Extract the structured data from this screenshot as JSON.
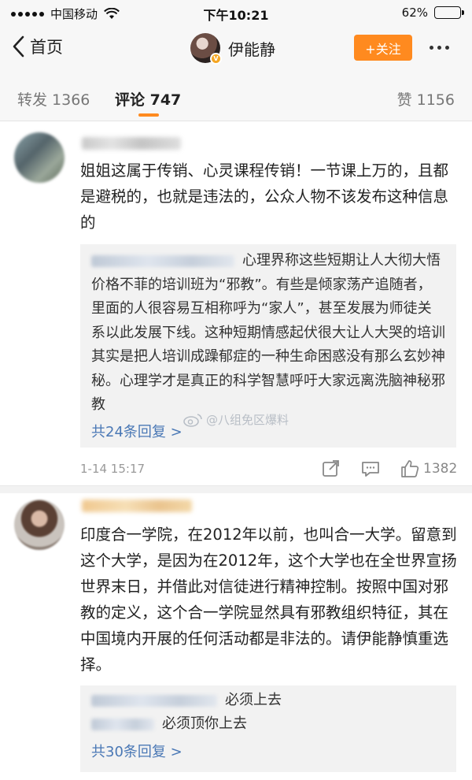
{
  "status_bar": {
    "carrier": "中国移动",
    "time": "下午10:21",
    "battery_percent": "62%",
    "battery_level": 0.62
  },
  "nav": {
    "back_label": "首页",
    "title": "伊能静",
    "follow_label": "+关注"
  },
  "tabs": {
    "repost": "转发 1366",
    "comment": "评论 747",
    "like": "赞 1156"
  },
  "comments": [
    {
      "text": "姐姐这属于传销、心灵课程传销！一节课上万的，且都是避税的，也就是违法的，公众人物不该发布这种信息的",
      "reply_text": "心理界称这些短期让人大彻大悟价格不菲的培训班为“邪教”。有些是倾家荡产追随者，里面的人很容易互相称呼为“家人”，甚至发展为师徒关系以此发展下线。这种短期情感起伏很大让人大哭的培训其实是把人培训成躁郁症的一种生命困惑没有那么玄妙神秘。心理学才是真正的科学智慧呼吁大家远离洗脑神秘邪教",
      "reply_count": "共24条回复 >",
      "time": "1-14 15:17",
      "likes": "1382"
    },
    {
      "text": "印度合一学院，在2012年以前，也叫合一大学。留意到这个大学，是因为在2012年，这个大学也在全世界宣扬世界末日，并借此对信徒进行精神控制。按照中国对邪教的定义，这个合一学院显然具有邪教组织特征，其在中国境内开展的任何活动都是非法的。请伊能静慎重选择。",
      "replies": [
        "必须上去",
        "必须顶你上去"
      ],
      "reply_count": "共30条回复 >"
    }
  ],
  "watermark": "@八组免区爆料",
  "colors": {
    "accent": "#ff8a1f",
    "link": "#4a78b5"
  },
  "icons": [
    "back-chevron-icon",
    "wifi-icon",
    "verified-badge-icon",
    "share-icon",
    "comment-icon",
    "like-icon",
    "weibo-logo-icon"
  ]
}
